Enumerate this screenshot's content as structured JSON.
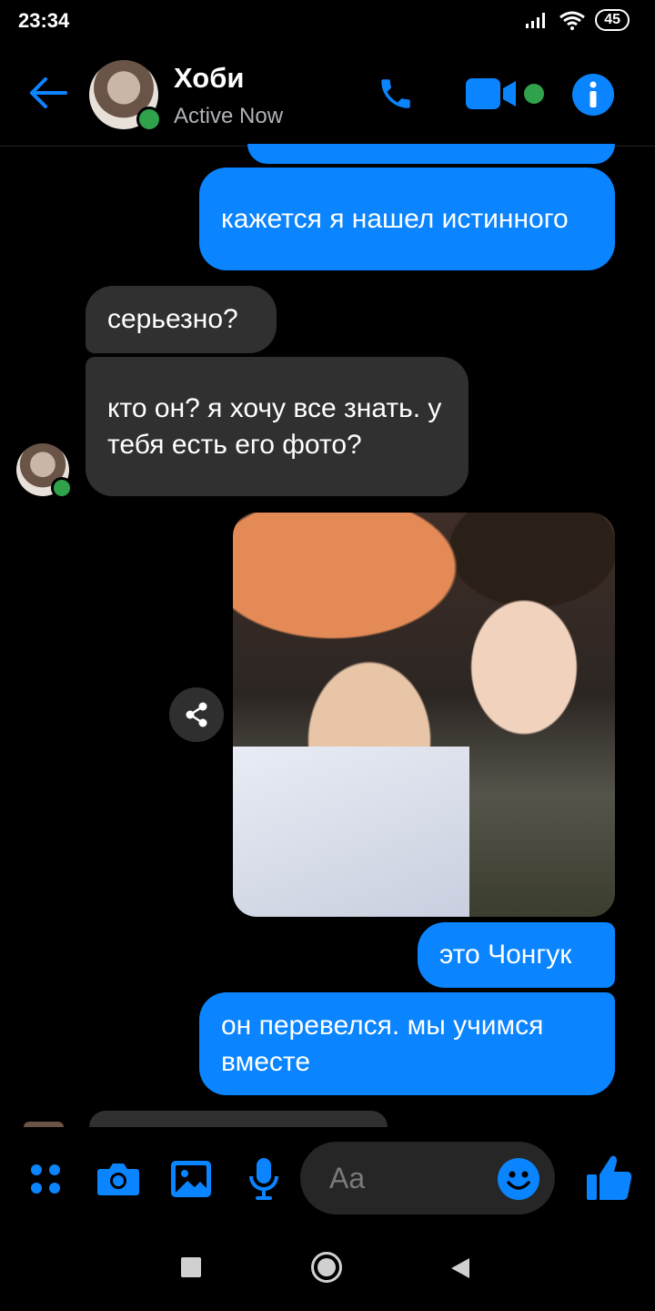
{
  "status_bar": {
    "time": "23:34",
    "battery": "45"
  },
  "header": {
    "name": "Хоби",
    "status": "Active Now"
  },
  "messages": [
    {
      "side": "out",
      "text": "кажется я нашел истинного"
    },
    {
      "side": "in",
      "text": "серьезно?"
    },
    {
      "side": "in",
      "text": "кто он? я хочу все знать. у тебя есть его фото?"
    },
    {
      "side": "out",
      "text": "это Чонгук"
    },
    {
      "side": "out",
      "text": "он перевелся. мы учимся вместе"
    }
  ],
  "composer": {
    "placeholder": "Aa"
  },
  "colors": {
    "accent": "#0a84ff",
    "incoming_bubble": "#303030",
    "online": "#31a24c",
    "background": "#000000"
  },
  "icons": {
    "header": [
      "back-arrow-icon",
      "phone-icon",
      "video-camera-icon",
      "info-icon"
    ],
    "composer": [
      "menu-dots-icon",
      "camera-icon",
      "gallery-icon",
      "microphone-icon",
      "emoji-icon",
      "thumbs-up-icon"
    ],
    "nav": [
      "recents-icon",
      "home-icon",
      "back-icon"
    ]
  }
}
